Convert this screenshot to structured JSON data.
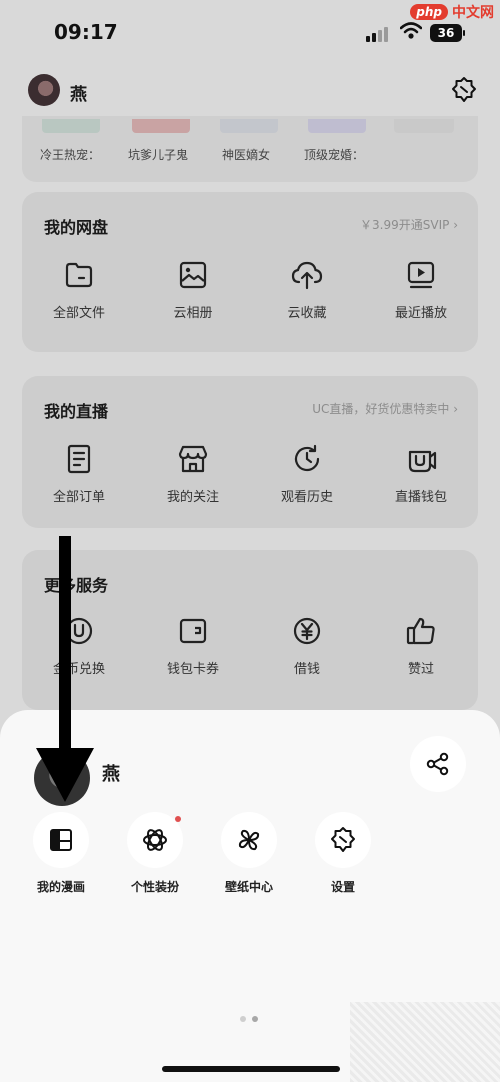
{
  "status_bar": {
    "time": "09:17",
    "battery": "36"
  },
  "watermark": {
    "badge": "php",
    "text": "中文网"
  },
  "header": {
    "username": "燕"
  },
  "recent": {
    "items": [
      "冷王热宠：",
      "坑爹儿子鬼",
      "神医嫡女",
      "顶级宠婚："
    ]
  },
  "netdisk": {
    "title": "我的网盘",
    "link": "￥3.99开通SVIP",
    "items": [
      "全部文件",
      "云相册",
      "云收藏",
      "最近播放"
    ]
  },
  "live": {
    "title": "我的直播",
    "link": "UC直播，好货优惠特卖中",
    "items": [
      "全部订单",
      "我的关注",
      "观看历史",
      "直播钱包"
    ]
  },
  "services": {
    "title": "更多服务",
    "items": [
      "金币兑换",
      "钱包卡券",
      "借钱",
      "赞过"
    ]
  },
  "sheet": {
    "username": "燕",
    "tiles": [
      "我的漫画",
      "个性装扮",
      "壁纸中心",
      "设置"
    ]
  },
  "colors": {
    "accent_red": "#e05050",
    "watermark_red": "#e33c2e",
    "overlay_gray": "#d9d9d9"
  }
}
